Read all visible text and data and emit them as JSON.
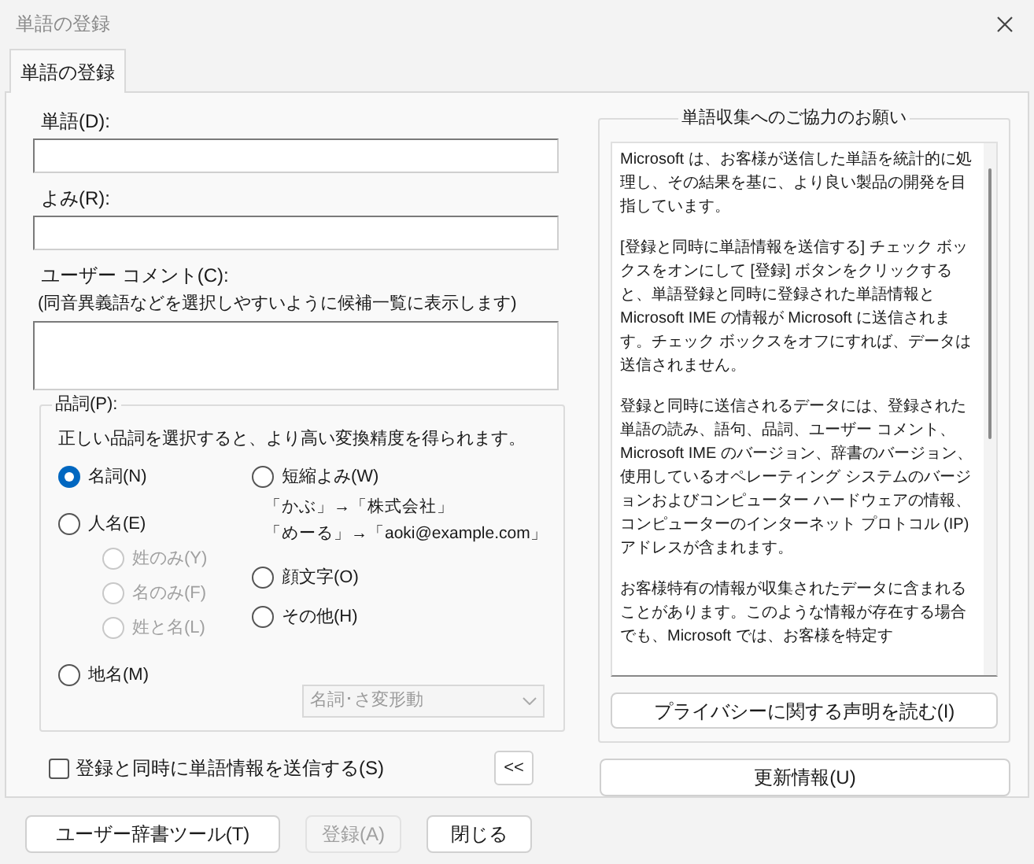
{
  "window": {
    "title": "単語の登録"
  },
  "tabs": [
    {
      "label": "単語の登録",
      "selected": true
    }
  ],
  "fields": [
    {
      "label": "単語(D):",
      "kind": "line"
    },
    {
      "label": "よみ(R):",
      "kind": "line"
    },
    {
      "label": "ユーザー コメント(C):",
      "hint": "(同音異義語などを選択しやすいように候補一覧に表示します)",
      "kind": "box"
    }
  ],
  "part_of_speech": {
    "title": "品詞(P):",
    "description": "正しい品詞を選択すると、より高い変換精度を得られます。",
    "left_options": [
      {
        "label": "名詞(N)",
        "selected": true,
        "disabled": false
      },
      {
        "label": "人名(E)",
        "selected": false,
        "disabled": false,
        "children": [
          {
            "label": "姓のみ(Y)",
            "selected": false,
            "disabled": true
          },
          {
            "label": "名のみ(F)",
            "selected": false,
            "disabled": true
          },
          {
            "label": "姓と名(L)",
            "selected": false,
            "disabled": true
          }
        ]
      },
      {
        "label": "地名(M)",
        "selected": false,
        "disabled": false
      }
    ],
    "right_options": [
      {
        "label": "短縮よみ(W)",
        "selected": false,
        "disabled": false,
        "examples": [
          "「かぶ」→「株式会社」",
          "「めーる」→「aoki@example.com」"
        ]
      },
      {
        "label": "顔文字(O)",
        "selected": false,
        "disabled": false
      },
      {
        "label": "その他(H)",
        "selected": false,
        "disabled": false
      }
    ],
    "dropdown": {
      "value": "名詞･さ変形動",
      "disabled": true
    }
  },
  "send_checkbox": {
    "label": "登録と同時に単語情報を送信する(S)",
    "checked": false
  },
  "collapse_button": "<<",
  "info_panel": {
    "title": "単語収集へのご協力のお願い",
    "paragraphs": [
      "Microsoft は、お客様が送信した単語を統計的に処理し、その結果を基に、より良い製品の開発を目指しています。",
      "[登録と同時に単語情報を送信する] チェック ボックスをオンにして [登録] ボタンをクリックすると、単語登録と同時に登録された単語情報と Microsoft IME の情報が Microsoft に送信されます。チェック ボックスをオフにすれば、データは送信されません。",
      "登録と同時に送信されるデータには、登録された単語の読み、語句、品詞、ユーザー コメント、Microsoft IME のバージョン、辞書のバージョン、使用しているオペレーティング システムのバージョンおよびコンピューター ハードウェアの情報、コンピューターのインターネット プロトコル (IP) アドレスが含まれます。",
      "お客様特有の情報が収集されたデータに含まれることがあります。このような情報が存在する場合でも、Microsoft では、お客様を特定す"
    ],
    "privacy_button": "プライバシーに関する声明を読む(I)"
  },
  "update_button": "更新情報(U)",
  "buttons": [
    {
      "label": "ユーザー辞書ツール(T)",
      "disabled": false
    },
    {
      "label": "登録(A)",
      "disabled": true
    },
    {
      "label": "閉じる",
      "disabled": false
    }
  ]
}
